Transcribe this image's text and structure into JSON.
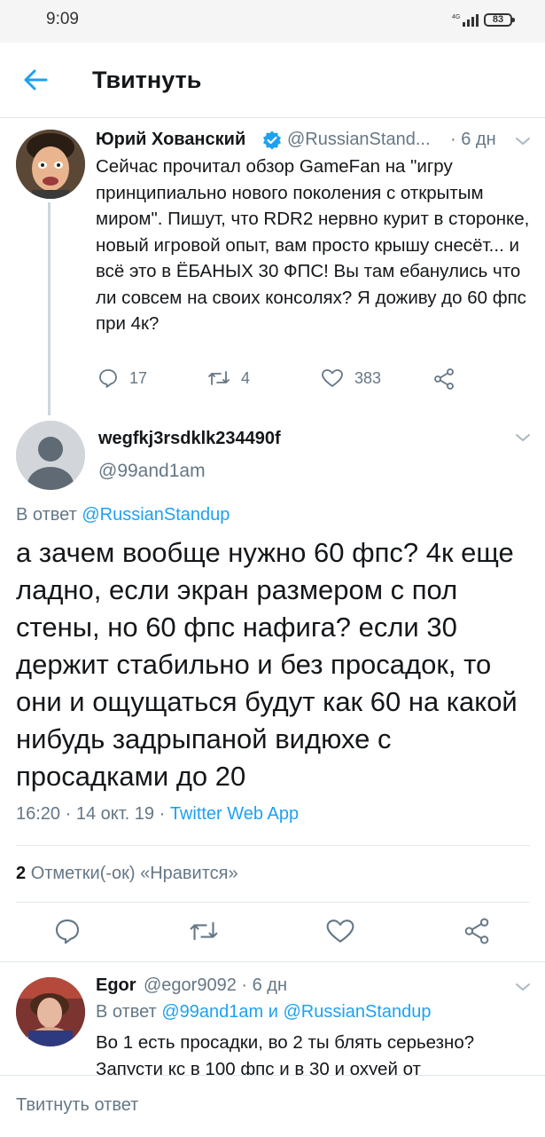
{
  "status_bar": {
    "time": "9:09",
    "network": "4G",
    "battery": "83"
  },
  "header": {
    "title": "Твитнуть",
    "back_icon": "arrow-left-icon"
  },
  "parent_tweet": {
    "name": "Юрий Хованский",
    "handle": "@RussianStand...",
    "time": "· 6 дн",
    "text": "Сейчас прочитал обзор GameFan на \"игру принципиально нового поколения с открытым миром\". Пишут, что RDR2 нервно курит в сторонке, новый игровой опыт, вам просто крышу снесёт... и всё это в ЁБАНЫХ 30 ФПС! Вы там ебанулись что ли совсем на своих консолях? Я доживу до 60 фпс при 4к?",
    "replies": "17",
    "retweets": "4",
    "likes": "383"
  },
  "main_tweet": {
    "name": "wegfkj3rsdklk234490f",
    "handle": "@99and1am",
    "reply_prefix": "В ответ",
    "reply_to": "@RussianStandup",
    "text": "а зачем вообще нужно 60 фпс? 4к еще ладно, если экран размером с пол стены, но 60 фпс нафига? если 30 держит стабильно и без просадок, то они и ощущаться будут как 60 на какой нибудь задрыпаной видюхе с просадками до 20",
    "time": "16:20 · 14 окт. 19 ·",
    "source": "Twitter Web App",
    "likes_count": "2",
    "likes_label": "Отметки(-ок) «Нравится»"
  },
  "reply_tweet": {
    "name": "Egor",
    "handle": "@egor9092 · 6 дн",
    "reply_prefix": "В ответ",
    "reply_to_1": "@99and1am",
    "reply_and": "и",
    "reply_to_2": "@RussianStandup",
    "text": "Во 1 есть просадки, во 2 ты блять серьезно? Запусти кс в 100 фпс и в 30 и охуей от"
  },
  "composer": {
    "placeholder": "Твитнуть ответ"
  },
  "colors": {
    "accent": "#1da1f2",
    "muted": "#657786",
    "text": "#14171a",
    "border": "#e1e8ed"
  }
}
